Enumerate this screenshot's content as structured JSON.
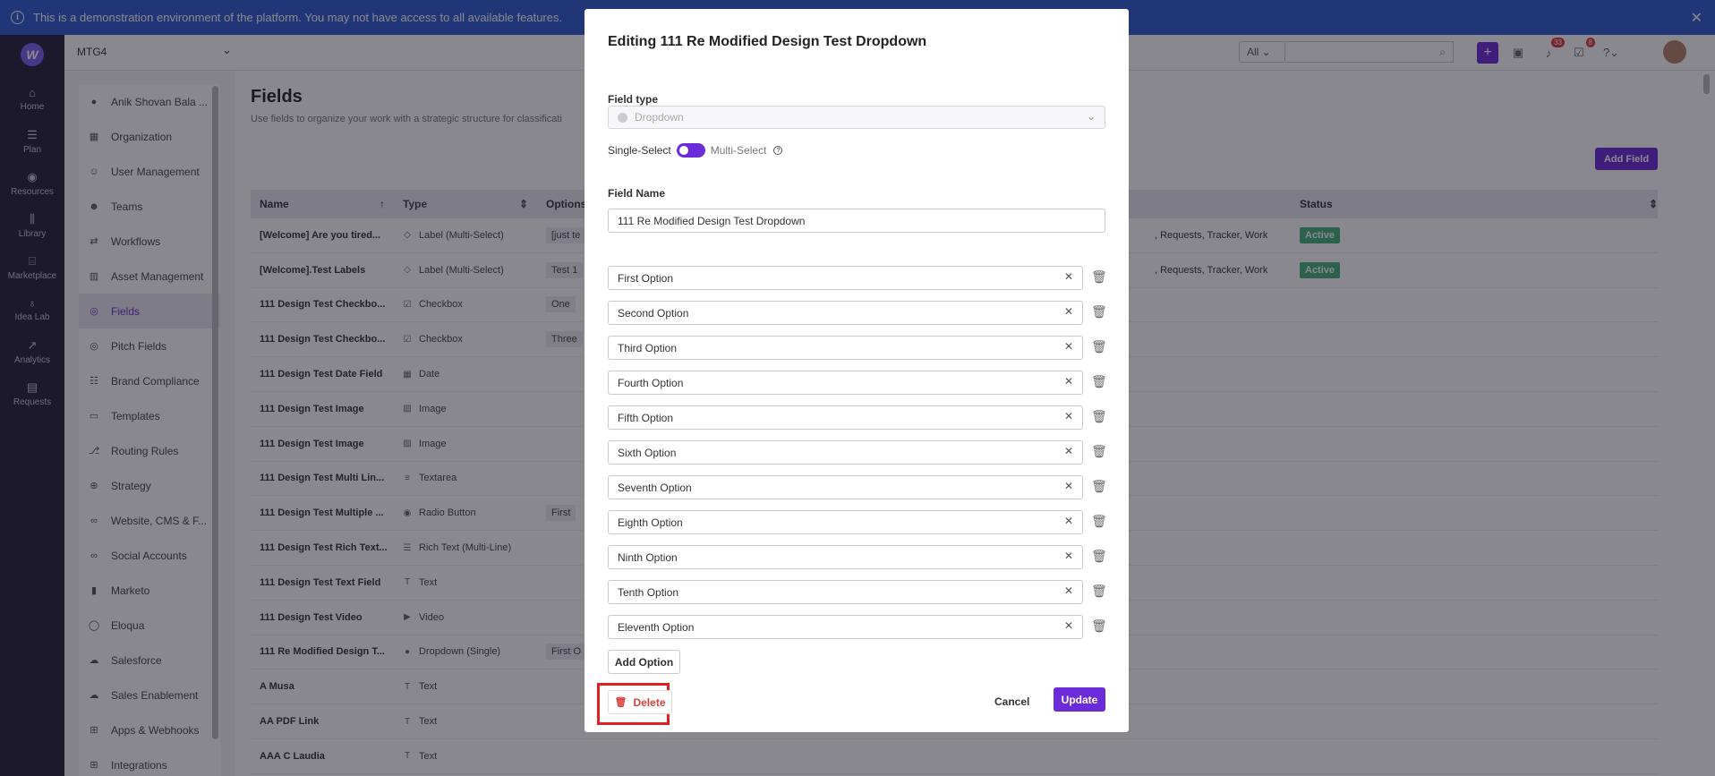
{
  "banner": {
    "text": "This is a demonstration environment of the platform. You may not have access to all available features."
  },
  "rail": {
    "items": [
      {
        "label": "Home",
        "icon": "home-icon"
      },
      {
        "label": "Plan",
        "icon": "list-icon"
      },
      {
        "label": "Resources",
        "icon": "stack-icon"
      },
      {
        "label": "Library",
        "icon": "books-icon"
      },
      {
        "label": "Marketplace",
        "icon": "store-icon"
      },
      {
        "label": "Idea Lab",
        "icon": "bulb-icon"
      },
      {
        "label": "Analytics",
        "icon": "trend-icon"
      },
      {
        "label": "Requests",
        "icon": "clipboard-icon"
      }
    ]
  },
  "topbar": {
    "org": "MTG4",
    "scope": "All",
    "notifications_count": "33",
    "tasks_count": "8"
  },
  "subnav": {
    "items": [
      "Anik Shovan Bala ...",
      "Organization",
      "User Management",
      "Teams",
      "Workflows",
      "Asset Management",
      "Fields",
      "Pitch Fields",
      "Brand Compliance",
      "Templates",
      "Routing Rules",
      "Strategy",
      "Website, CMS & F...",
      "Social Accounts",
      "Marketo",
      "Eloqua",
      "Salesforce",
      "Sales Enablement",
      "Apps & Webhooks",
      "Integrations"
    ]
  },
  "main": {
    "title": "Fields",
    "subtitle": "Use fields to organize your work with a strategic structure for classificati",
    "add_field": "Add Field",
    "columns": {
      "name": "Name",
      "type": "Type",
      "options": "Options",
      "status": "Status"
    },
    "rows": [
      {
        "name": "[Welcome] Are you tired...",
        "type": "Label (Multi-Select)",
        "option": "[just te",
        "categories": ", Requests, Tracker, Work",
        "status": "Active"
      },
      {
        "name": "[Welcome].Test Labels",
        "type": "Label (Multi-Select)",
        "option": "Test 1",
        "categories": ", Requests, Tracker, Work",
        "status": "Active"
      },
      {
        "name": "111 Design Test Checkbo...",
        "type": "Checkbox",
        "option": "One",
        "categories": "",
        "status": ""
      },
      {
        "name": "111 Design Test Checkbo...",
        "type": "Checkbox",
        "option": "Three",
        "categories": "",
        "status": ""
      },
      {
        "name": "111 Design Test Date Field",
        "type": "Date",
        "option": "",
        "categories": "",
        "status": ""
      },
      {
        "name": "111 Design Test Image",
        "type": "Image",
        "option": "",
        "categories": "",
        "status": ""
      },
      {
        "name": "111 Design Test Image",
        "type": "Image",
        "option": "",
        "categories": "",
        "status": ""
      },
      {
        "name": "111 Design Test Multi Lin...",
        "type": "Textarea",
        "option": "",
        "categories": "",
        "status": ""
      },
      {
        "name": "111 Design Test Multiple ...",
        "type": "Radio Button",
        "option": "First",
        "categories": "",
        "status": ""
      },
      {
        "name": "111 Design Test Rich Text...",
        "type": "Rich Text (Multi-Line)",
        "option": "",
        "categories": "",
        "status": ""
      },
      {
        "name": "111 Design Test Text Field",
        "type": "Text",
        "option": "",
        "categories": "",
        "status": ""
      },
      {
        "name": "111 Design Test Video",
        "type": "Video",
        "option": "",
        "categories": "",
        "status": ""
      },
      {
        "name": "111 Re Modified Design T...",
        "type": "Dropdown (Single)",
        "option": "First O",
        "categories": "",
        "status": ""
      },
      {
        "name": "A Musa",
        "type": "Text",
        "option": "",
        "categories": "",
        "status": ""
      },
      {
        "name": "AA PDF Link",
        "type": "Text",
        "option": "",
        "categories": "",
        "status": ""
      },
      {
        "name": "AAA C Laudia",
        "type": "Text",
        "option": "",
        "categories": "",
        "status": ""
      }
    ]
  },
  "modal": {
    "title": "Editing 111 Re Modified Design Test Dropdown",
    "field_type_label": "Field type",
    "field_type_value": "Dropdown",
    "single_select": "Single-Select",
    "multi_select": "Multi-Select",
    "field_name_label": "Field Name",
    "field_name_value": "111 Re Modified Design Test Dropdown",
    "options": [
      "First Option",
      "Second Option",
      "Third Option",
      "Fourth Option",
      "Fifth Option",
      "Sixth Option",
      "Seventh Option",
      "Eighth Option",
      "Ninth Option",
      "Tenth Option",
      "Eleventh Option"
    ],
    "add_option": "Add Option",
    "delete": "Delete",
    "cancel": "Cancel",
    "update": "Update"
  },
  "colors": {
    "accent": "#6b2bd9",
    "banner": "#2f5bd0",
    "rail": "#24203a",
    "active_status": "#45b07a",
    "danger": "#d8423c"
  }
}
